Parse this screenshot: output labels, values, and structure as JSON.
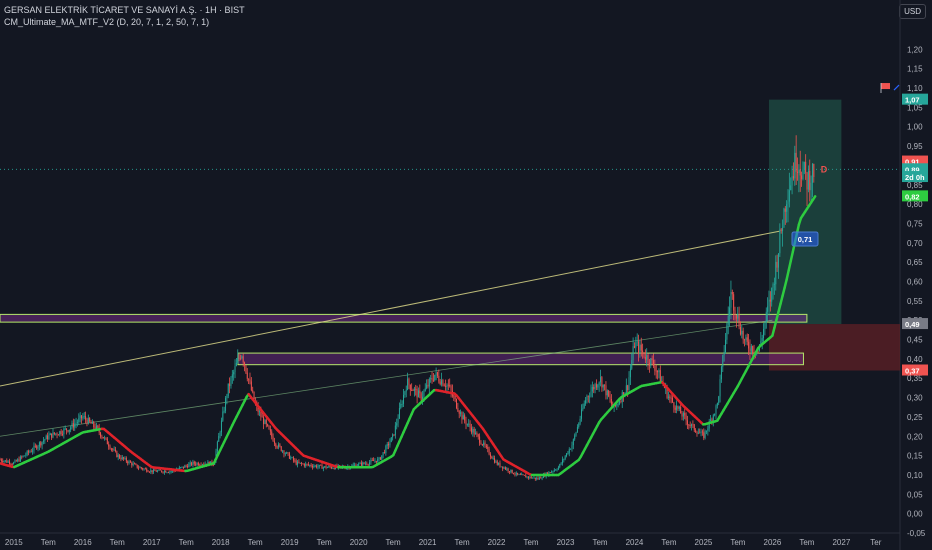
{
  "header": {
    "title": "GERSAN ELEKTRİK TİCARET VE SANAYİ A.Ş. · 1H · BIST",
    "indicator": "CM_Ultimate_MA_MTF_V2 (D, 20, 7, 1, 2, 50, 7, 1)",
    "currency": "USD"
  },
  "colors": {
    "background": "#131722",
    "candle_up": "#26a69a",
    "candle_down": "#ef5350",
    "ma_up": "#2ecc40",
    "ma_down": "#e0222a",
    "trendline": "#e7e38f",
    "zone_fill": "#7b2d8e",
    "zone_border": "#b5e86a",
    "target_fill": "#1f4e44",
    "stop_fill": "#5a1f26"
  },
  "chart_data": {
    "type": "candlestick",
    "ylim": [
      -0.05,
      1.25
    ],
    "y_ticks": [
      "1,20",
      "1,15",
      "1,10",
      "1,05",
      "1,00",
      "0,95",
      "0,90",
      "0,85",
      "0,80",
      "0,75",
      "0,70",
      "0,65",
      "0,60",
      "0,55",
      "0,50",
      "0,45",
      "0,40",
      "0,35",
      "0,30",
      "0,25",
      "0,20",
      "0,15",
      "0,10",
      "0,05",
      "0,00",
      "-0,05"
    ],
    "y_tick_values": [
      1.2,
      1.15,
      1.1,
      1.05,
      1.0,
      0.95,
      0.9,
      0.85,
      0.8,
      0.75,
      0.7,
      0.65,
      0.6,
      0.55,
      0.5,
      0.45,
      0.4,
      0.35,
      0.3,
      0.25,
      0.2,
      0.15,
      0.1,
      0.05,
      0.0,
      -0.05
    ],
    "x_ticks": [
      "2015",
      "Tem",
      "2016",
      "Tem",
      "2017",
      "Tem",
      "2018",
      "Tem",
      "2019",
      "Tem",
      "2020",
      "Tem",
      "2021",
      "Tem",
      "2022",
      "Tem",
      "2023",
      "Tem",
      "2024",
      "Tem",
      "2025",
      "Tem",
      "2026",
      "Tem",
      "2027",
      "Ter"
    ],
    "x_tick_values": [
      2015.0,
      2015.5,
      2016.0,
      2016.5,
      2017.0,
      2017.5,
      2018.0,
      2018.5,
      2019.0,
      2019.5,
      2020.0,
      2020.5,
      2021.0,
      2021.5,
      2022.0,
      2022.5,
      2023.0,
      2023.5,
      2024.0,
      2024.5,
      2025.0,
      2025.5,
      2026.0,
      2026.5,
      2027.0,
      2027.5
    ],
    "xlim": [
      2014.8,
      2027.85
    ],
    "price_path": [
      [
        2014.8,
        0.14
      ],
      [
        2015.0,
        0.13
      ],
      [
        2015.3,
        0.17
      ],
      [
        2015.5,
        0.2
      ],
      [
        2015.8,
        0.22
      ],
      [
        2016.0,
        0.25
      ],
      [
        2016.2,
        0.22
      ],
      [
        2016.5,
        0.15
      ],
      [
        2016.8,
        0.12
      ],
      [
        2017.0,
        0.11
      ],
      [
        2017.3,
        0.11
      ],
      [
        2017.6,
        0.13
      ],
      [
        2017.9,
        0.13
      ],
      [
        2018.1,
        0.32
      ],
      [
        2018.3,
        0.42
      ],
      [
        2018.5,
        0.28
      ],
      [
        2018.8,
        0.18
      ],
      [
        2019.1,
        0.13
      ],
      [
        2019.5,
        0.12
      ],
      [
        2019.8,
        0.12
      ],
      [
        2020.1,
        0.13
      ],
      [
        2020.3,
        0.14
      ],
      [
        2020.5,
        0.2
      ],
      [
        2020.7,
        0.34
      ],
      [
        2020.9,
        0.3
      ],
      [
        2021.1,
        0.36
      ],
      [
        2021.3,
        0.33
      ],
      [
        2021.5,
        0.25
      ],
      [
        2021.8,
        0.18
      ],
      [
        2022.0,
        0.13
      ],
      [
        2022.3,
        0.1
      ],
      [
        2022.6,
        0.09
      ],
      [
        2022.9,
        0.12
      ],
      [
        2023.1,
        0.18
      ],
      [
        2023.3,
        0.3
      ],
      [
        2023.5,
        0.35
      ],
      [
        2023.7,
        0.27
      ],
      [
        2023.9,
        0.33
      ],
      [
        2024.0,
        0.44
      ],
      [
        2024.3,
        0.38
      ],
      [
        2024.5,
        0.3
      ],
      [
        2024.8,
        0.23
      ],
      [
        2025.0,
        0.2
      ],
      [
        2025.2,
        0.28
      ],
      [
        2025.4,
        0.57
      ],
      [
        2025.6,
        0.44
      ],
      [
        2025.8,
        0.42
      ],
      [
        2026.0,
        0.58
      ],
      [
        2026.2,
        0.82
      ],
      [
        2026.35,
        0.92
      ],
      [
        2026.5,
        0.86
      ],
      [
        2026.62,
        0.89
      ]
    ],
    "ma_path": [
      [
        2014.8,
        0.13
      ],
      [
        2015.0,
        0.12
      ],
      [
        2015.5,
        0.16
      ],
      [
        2016.0,
        0.21
      ],
      [
        2016.3,
        0.22
      ],
      [
        2016.7,
        0.16
      ],
      [
        2017.0,
        0.12
      ],
      [
        2017.5,
        0.11
      ],
      [
        2017.9,
        0.13
      ],
      [
        2018.2,
        0.24
      ],
      [
        2018.4,
        0.31
      ],
      [
        2018.8,
        0.22
      ],
      [
        2019.2,
        0.15
      ],
      [
        2019.7,
        0.12
      ],
      [
        2020.2,
        0.12
      ],
      [
        2020.5,
        0.15
      ],
      [
        2020.8,
        0.27
      ],
      [
        2021.1,
        0.32
      ],
      [
        2021.4,
        0.31
      ],
      [
        2021.8,
        0.22
      ],
      [
        2022.1,
        0.14
      ],
      [
        2022.5,
        0.1
      ],
      [
        2022.9,
        0.1
      ],
      [
        2023.2,
        0.14
      ],
      [
        2023.5,
        0.24
      ],
      [
        2023.8,
        0.3
      ],
      [
        2024.1,
        0.33
      ],
      [
        2024.4,
        0.34
      ],
      [
        2024.7,
        0.28
      ],
      [
        2025.0,
        0.23
      ],
      [
        2025.2,
        0.24
      ],
      [
        2025.5,
        0.33
      ],
      [
        2025.8,
        0.43
      ],
      [
        2026.0,
        0.46
      ],
      [
        2026.2,
        0.6
      ],
      [
        2026.4,
        0.76
      ],
      [
        2026.62,
        0.82
      ]
    ],
    "price_levels": [
      {
        "label": "1,07",
        "value": 1.07,
        "color": "#26a69a"
      },
      {
        "label": "0,91",
        "value": 0.91,
        "color": "#ef5350"
      },
      {
        "label": "0,89",
        "value": 0.89,
        "color": "#26a69a"
      },
      {
        "label": "2d 0h",
        "value": 0.87,
        "color": "#26a69a"
      },
      {
        "label": "0,82",
        "value": 0.82,
        "color": "#2ecc40"
      },
      {
        "label": "0,49",
        "value": 0.49,
        "color": "#787b86"
      },
      {
        "label": "0,37",
        "value": 0.37,
        "color": "#ef5350"
      }
    ],
    "ma_label": "0,71",
    "annotation": "D"
  }
}
